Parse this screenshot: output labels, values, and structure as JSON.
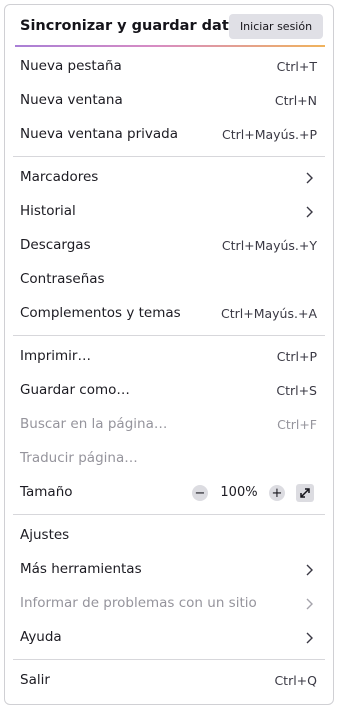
{
  "header": {
    "title": "Sincronizar y guardar datos",
    "signin_label": "Iniciar sesión",
    "accent_gradient": [
      "#a97fd6",
      "#d78cc4",
      "#f0b35c"
    ]
  },
  "items": {
    "new_tab": {
      "label": "Nueva pestaña",
      "shortcut": "Ctrl+T"
    },
    "new_window": {
      "label": "Nueva ventana",
      "shortcut": "Ctrl+N"
    },
    "new_private_window": {
      "label": "Nueva ventana privada",
      "shortcut": "Ctrl+Mayús.+P"
    },
    "bookmarks": {
      "label": "Marcadores",
      "icon": "chevron-right-icon"
    },
    "history": {
      "label": "Historial",
      "icon": "chevron-right-icon"
    },
    "downloads": {
      "label": "Descargas",
      "shortcut": "Ctrl+Mayús.+Y"
    },
    "passwords": {
      "label": "Contraseñas"
    },
    "addons": {
      "label": "Complementos y temas",
      "shortcut": "Ctrl+Mayús.+A"
    },
    "print": {
      "label": "Imprimir…",
      "shortcut": "Ctrl+P"
    },
    "save_as": {
      "label": "Guardar como…",
      "shortcut": "Ctrl+S"
    },
    "find": {
      "label": "Buscar en la página…",
      "shortcut": "Ctrl+F",
      "disabled": true
    },
    "translate": {
      "label": "Traducir página…",
      "disabled": true
    },
    "zoom": {
      "label": "Tamaño",
      "value": "100%",
      "minus": "−",
      "plus": "+"
    },
    "settings": {
      "label": "Ajustes"
    },
    "more_tools": {
      "label": "Más herramientas",
      "icon": "chevron-right-icon"
    },
    "report_site": {
      "label": "Informar de problemas con un sitio",
      "icon": "chevron-right-icon",
      "disabled": true
    },
    "help": {
      "label": "Ayuda",
      "icon": "chevron-right-icon"
    },
    "exit": {
      "label": "Salir",
      "shortcut": "Ctrl+Q"
    }
  }
}
